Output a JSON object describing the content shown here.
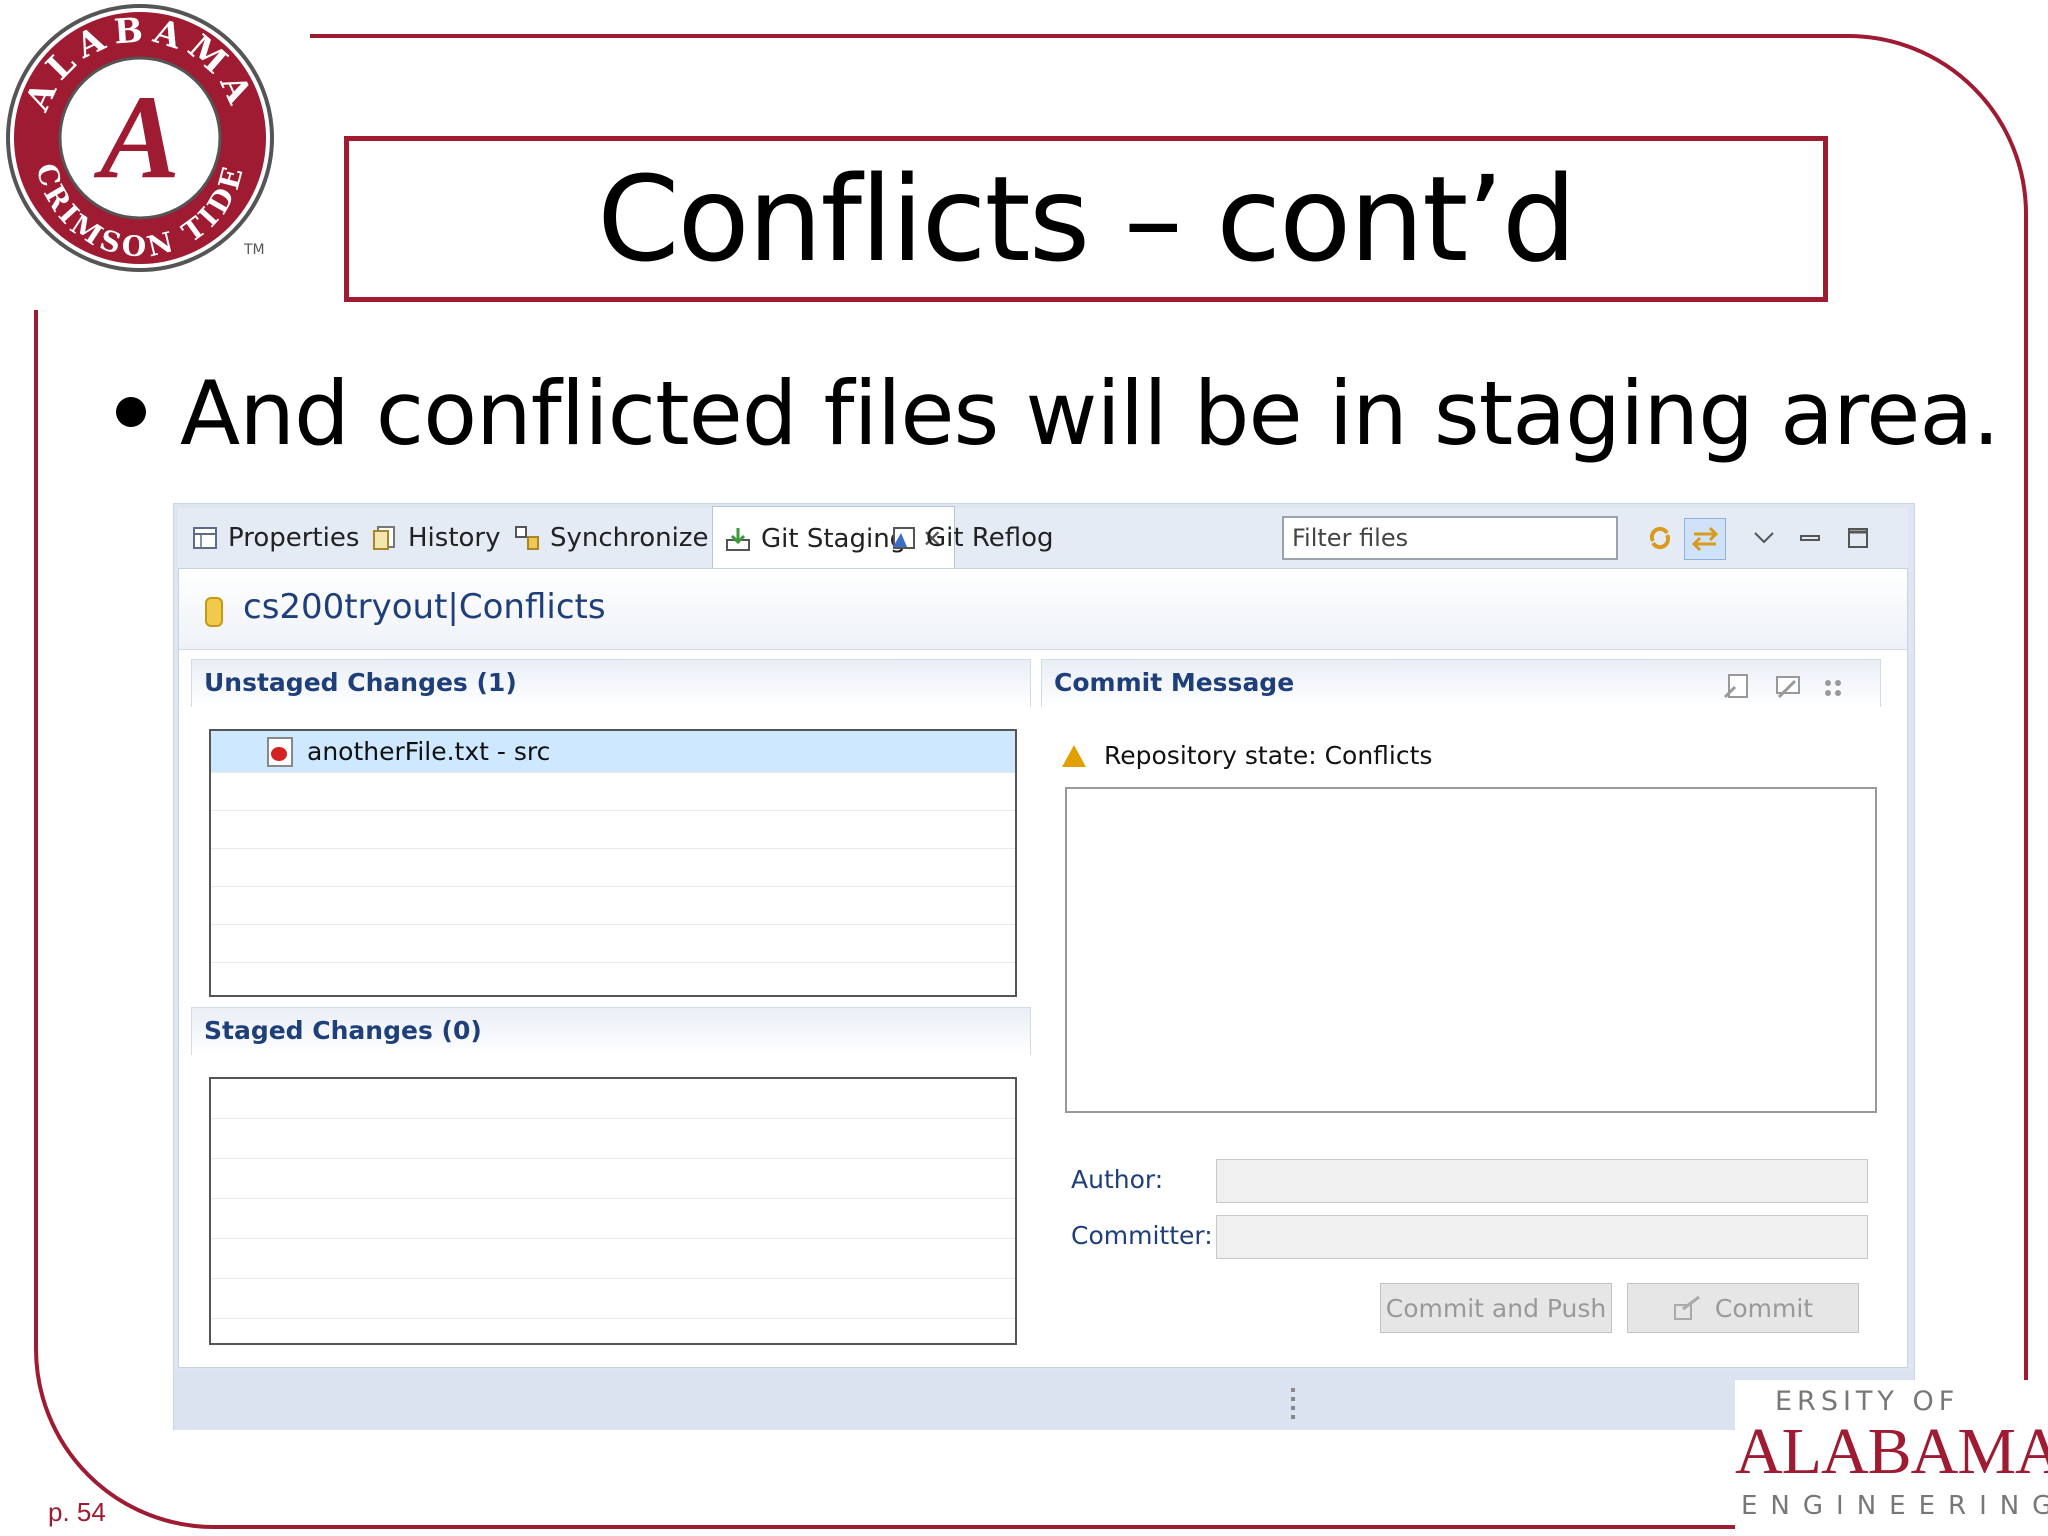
{
  "slide": {
    "title": "Conflicts – cont’d",
    "bullet": "And conflicted files will be in staging area.",
    "page_number": "p. 54",
    "logo_seal": {
      "ring_text": "ALABAMA CRIMSON TIDE",
      "letter": "A",
      "tm": "TM"
    },
    "logo_engineering": {
      "line1": "ERSITY OF",
      "line2": "ALABAMA",
      "line3": "ENGINEERING"
    },
    "colors": {
      "crimson": "#9e1b32"
    }
  },
  "eclipse": {
    "tabs": [
      {
        "label": "Properties",
        "icon": "properties-icon"
      },
      {
        "label": "History",
        "icon": "history-icon"
      },
      {
        "label": "Synchronize",
        "icon": "synchronize-icon"
      },
      {
        "label": "Git Staging",
        "icon": "git-staging-icon",
        "active": true
      },
      {
        "label": "Git Reflog",
        "icon": "git-reflog-icon"
      }
    ],
    "filter_placeholder": "Filter files",
    "repository_label": "cs200tryout|Conflicts",
    "unstaged": {
      "header": "Unstaged Changes (1)",
      "items": [
        "anotherFile.txt - src"
      ]
    },
    "staged": {
      "header": "Staged Changes (0)"
    },
    "commit": {
      "header": "Commit Message",
      "repo_state": "Repository state: Conflicts",
      "author_label": "Author:",
      "committer_label": "Committer:",
      "commit_and_push": "Commit and Push",
      "commit": "Commit"
    }
  }
}
